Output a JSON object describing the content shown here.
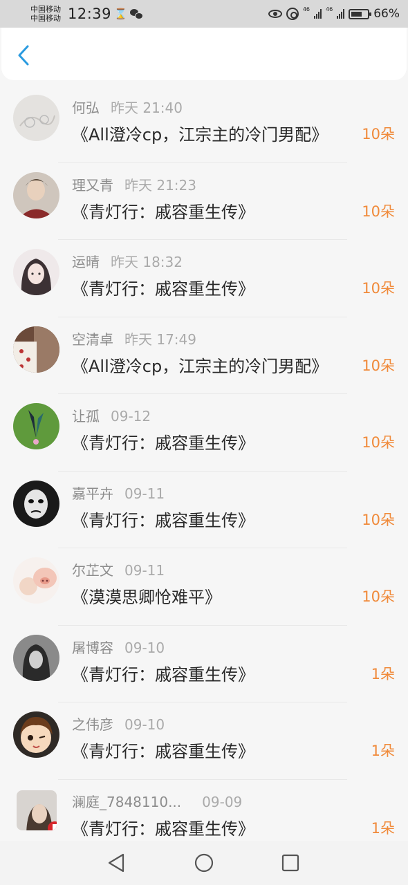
{
  "status_bar": {
    "carrier_1": "中国移动",
    "carrier_2": "中国移动",
    "time": "12:39",
    "hourglass_glyph": "⌛",
    "network_1": "46",
    "network_2": "46",
    "battery_level": 0.66,
    "battery": "66%",
    "icons": [
      "hourglass-icon",
      "wechat-icon",
      "eye-icon",
      "hotspot-icon",
      "signal-icon",
      "battery-icon"
    ]
  },
  "header": {
    "back_icon": "chevron-left-icon",
    "accent_color": "#2a9be0"
  },
  "items": [
    {
      "name": "何弘",
      "date": "昨天 21:40",
      "title": "《All澄冷cp，江宗主的冷门男配》",
      "count": "10朵"
    },
    {
      "name": "理又青",
      "date": "昨天 21:23",
      "title": "《青灯行：戚容重生传》",
      "count": "10朵"
    },
    {
      "name": "运晴",
      "date": "昨天 18:32",
      "title": "《青灯行：戚容重生传》",
      "count": "10朵"
    },
    {
      "name": "空清卓",
      "date": "昨天 17:49",
      "title": "《All澄冷cp，江宗主的冷门男配》",
      "count": "10朵"
    },
    {
      "name": "让孤",
      "date": "09-12",
      "title": "《青灯行：戚容重生传》",
      "count": "10朵"
    },
    {
      "name": "嘉平卉",
      "date": "09-11",
      "title": "《青灯行：戚容重生传》",
      "count": "10朵"
    },
    {
      "name": "尔芷文",
      "date": "09-11",
      "title": "《漠漠思卿怆难平》",
      "count": "10朵"
    },
    {
      "name": "屠博容",
      "date": "09-10",
      "title": "《青灯行：戚容重生传》",
      "count": "1朵"
    },
    {
      "name": "之伟彦",
      "date": "09-10",
      "title": "《青灯行：戚容重生传》",
      "count": "1朵"
    },
    {
      "name": "澜庭_7848110...",
      "date": "09-09",
      "title": "《青灯行：戚容重生传》",
      "count": "1朵"
    }
  ],
  "colors": {
    "count": "#f08a3a",
    "name": "#8d8d8d",
    "title": "#2a2a2a"
  },
  "nav_bar": {
    "icons": [
      "back-triangle-icon",
      "home-circle-icon",
      "recents-square-icon"
    ]
  }
}
